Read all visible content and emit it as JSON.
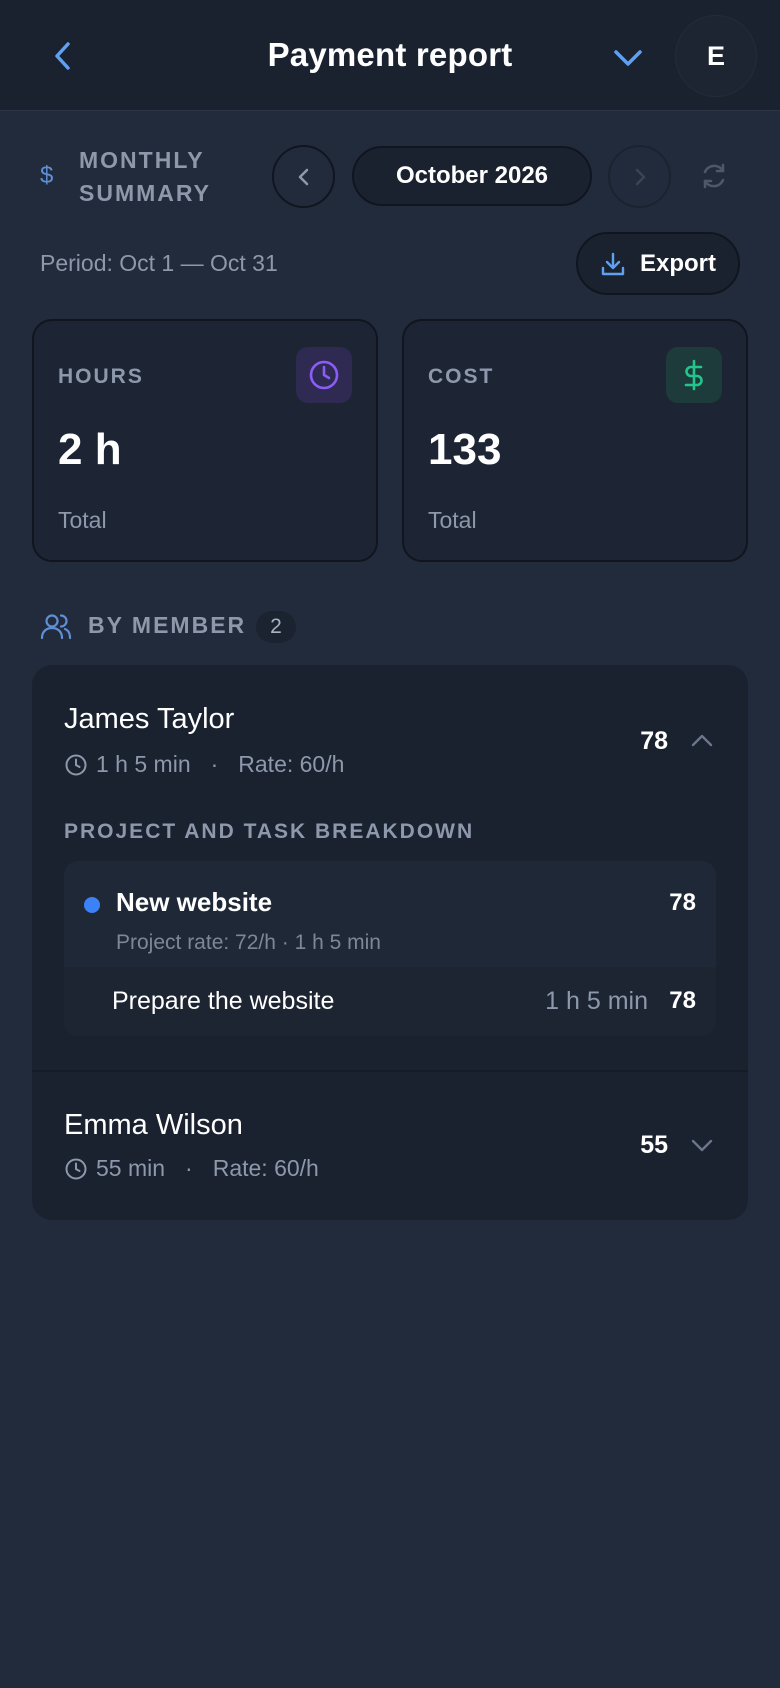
{
  "header": {
    "title": "Payment report",
    "avatar_initial": "E",
    "back_icon": "chevron-left-icon",
    "menu_icon": "chevron-down-icon"
  },
  "summary": {
    "currency_symbol": "$",
    "label": "MONTHLY SUMMARY",
    "month": "October 2026",
    "period": "Period: Oct 1 — Oct 31",
    "export_label": "Export"
  },
  "stats": {
    "hours": {
      "label": "HOURS",
      "value": "2 h",
      "sub": "Total",
      "icon": "clock-icon",
      "accent": "#8b5cf6"
    },
    "cost": {
      "label": "COST",
      "value": "133",
      "sub": "Total",
      "icon": "dollar-icon",
      "accent": "#22c58b"
    }
  },
  "members": {
    "label": "BY MEMBER",
    "count": "2",
    "items": [
      {
        "name": "James Taylor",
        "duration": "1 h 5 min",
        "rate": "Rate: 60/h",
        "amount": "78",
        "expanded": true,
        "breakdown_label": "PROJECT AND TASK BREAKDOWN",
        "project": {
          "name": "New website",
          "amount": "78",
          "meta": "Project rate: 72/h  ·  1 h 5 min",
          "color": "#3b82f6",
          "task": {
            "name": "Prepare the website",
            "duration": "1 h 5 min",
            "amount": "78"
          }
        }
      },
      {
        "name": "Emma Wilson",
        "duration": "55 min",
        "rate": "Rate: 60/h",
        "amount": "55",
        "expanded": false
      }
    ]
  },
  "colors": {
    "background": "#222b3b",
    "header": "#1a2230",
    "accent_blue": "#5fa0f0",
    "muted_text": "#8d98ab"
  }
}
